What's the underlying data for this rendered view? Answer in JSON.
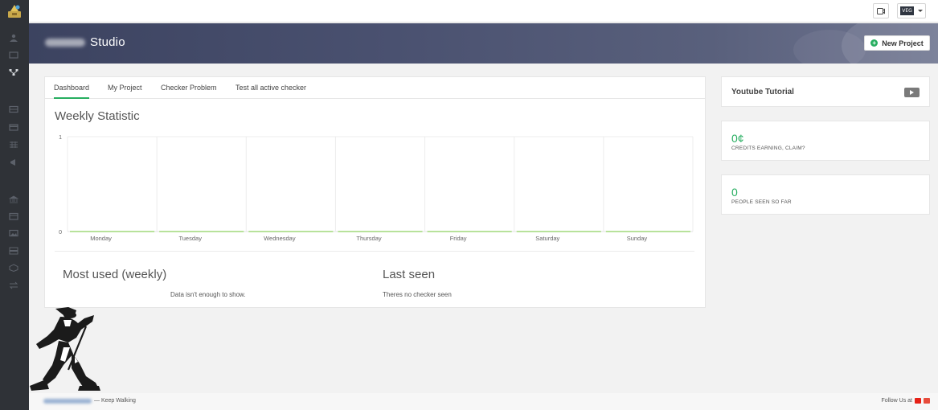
{
  "header": {
    "studio_suffix": "Studio",
    "new_project_label": "New Project",
    "lang_label": "VEG"
  },
  "tabs": [
    {
      "label": "Dashboard",
      "active": true
    },
    {
      "label": "My Project",
      "active": false
    },
    {
      "label": "Checker Problem",
      "active": false
    },
    {
      "label": "Test all active checker",
      "active": false
    }
  ],
  "main": {
    "chart_title": "Weekly Statistic",
    "most_used_title": "Most used (weekly)",
    "most_used_text": "Data isn't enough to show.",
    "last_seen_title": "Last seen",
    "last_seen_text": "Theres no checker seen"
  },
  "chart_data": {
    "type": "line",
    "categories": [
      "Monday",
      "Tuesday",
      "Wednesday",
      "Thursday",
      "Friday",
      "Saturday",
      "Sunday"
    ],
    "values": [
      0,
      0,
      0,
      0,
      0,
      0,
      0
    ],
    "ylim": [
      0,
      1
    ],
    "yticks": [
      "1",
      "0"
    ],
    "grid": true,
    "line_color": "#8ed15f"
  },
  "widgets": {
    "youtube_title": "Youtube Tutorial",
    "credits_value": "0¢",
    "credits_label": "CREDITS EARNING, CLAIM?",
    "people_value": "0",
    "people_label": "PEOPLE SEEN SO FAR"
  },
  "footer": {
    "tagline": "— Keep Walking",
    "follow_label": "Follow Us at"
  },
  "colors": {
    "accent": "#27ae60",
    "sidebar": "#2f3237",
    "banner": "#4a5170"
  }
}
